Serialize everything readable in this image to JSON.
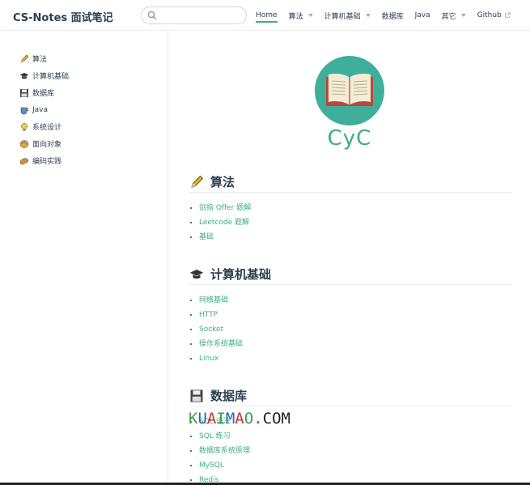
{
  "navbar": {
    "site_name": "CS-Notes 面试笔记",
    "search_placeholder": "",
    "items": [
      {
        "label": "Home",
        "active": true,
        "dropdown": false
      },
      {
        "label": "算法",
        "active": false,
        "dropdown": true
      },
      {
        "label": "计算机基础",
        "active": false,
        "dropdown": true
      },
      {
        "label": "数据库",
        "active": false,
        "dropdown": false
      },
      {
        "label": "Java",
        "active": false,
        "dropdown": false
      },
      {
        "label": "其它",
        "active": false,
        "dropdown": true
      },
      {
        "label": "Github",
        "active": false,
        "dropdown": false,
        "external": true
      }
    ]
  },
  "sidebar": {
    "items": [
      {
        "label": "算法",
        "icon": "pencil-icon"
      },
      {
        "label": "计算机基础",
        "icon": "graduation-cap-icon"
      },
      {
        "label": "数据库",
        "icon": "floppy-disk-icon"
      },
      {
        "label": "Java",
        "icon": "coffee-icon"
      },
      {
        "label": "系统设计",
        "icon": "lightbulb-icon"
      },
      {
        "label": "面向对象",
        "icon": "palette-icon"
      },
      {
        "label": "编码实践",
        "icon": "bread-icon"
      }
    ]
  },
  "main": {
    "logo_text": "CyC",
    "sections": [
      {
        "title": "算法",
        "icon": "pencil-icon",
        "links": [
          "剑指 Offer 题解",
          "Leetcode 题解",
          "基础"
        ]
      },
      {
        "title": "计算机基础",
        "icon": "graduation-cap-icon",
        "links": [
          "网络基础",
          "HTTP",
          "Socket",
          "操作系统基础",
          "Linux"
        ]
      },
      {
        "title": "数据库",
        "icon": "floppy-disk-icon",
        "links": [
          "SQL 语法",
          "SQL 练习",
          "数据库系统原理",
          "MySQL",
          "Redis"
        ]
      }
    ]
  },
  "watermark": "KUAIMAO.COM",
  "colors": {
    "accent": "#3eaf7c",
    "text": "#2c3e50",
    "border": "#eaecef"
  }
}
